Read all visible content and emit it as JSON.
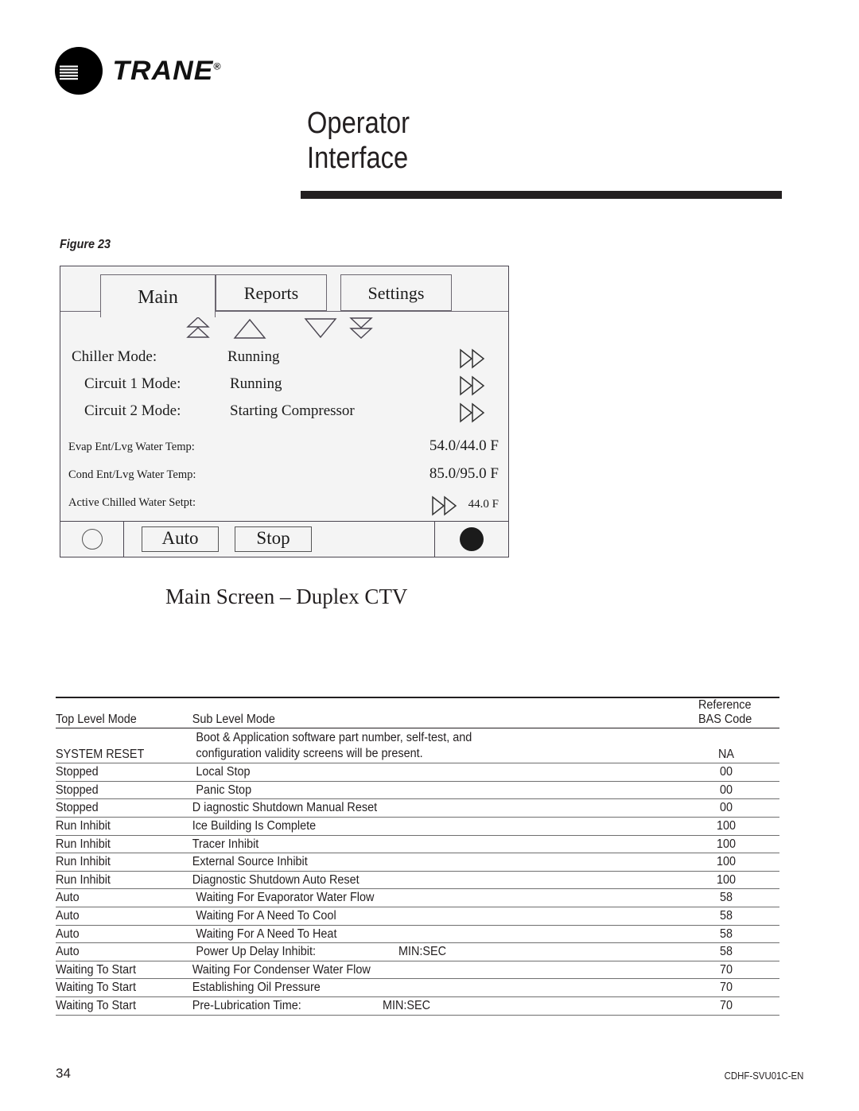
{
  "brand": {
    "name": "TRANE",
    "registered_mark": "®",
    "logo_icon": "trane-circle-logo"
  },
  "header": {
    "title": "Operator\nInterface"
  },
  "figure": {
    "label": "Figure 23",
    "caption": "Main Screen – Duplex CTV"
  },
  "device": {
    "tabs": [
      {
        "id": "main",
        "label": "Main",
        "active": true
      },
      {
        "id": "reports",
        "label": "Reports",
        "active": false
      },
      {
        "id": "settings",
        "label": "Settings",
        "active": false
      }
    ],
    "nav_arrows": [
      {
        "icon": "double-up-arrow-icon"
      },
      {
        "icon": "up-arrow-icon"
      },
      {
        "icon": "down-arrow-icon"
      },
      {
        "icon": "double-down-arrow-icon"
      }
    ],
    "mode_rows": [
      {
        "label": "Chiller Mode:",
        "value": "Running",
        "chevron": "double-right-chevron-icon"
      },
      {
        "label": "Circuit 1 Mode:",
        "value": "Running",
        "chevron": "double-right-chevron-icon"
      },
      {
        "label": "Circuit 2 Mode:",
        "value": "Starting Compressor",
        "chevron": "double-right-chevron-icon"
      }
    ],
    "temp_rows": [
      {
        "label": "Evap Ent/Lvg Water Temp:",
        "value": "54.0/44.0 F"
      },
      {
        "label": "Cond Ent/Lvg Water Temp:",
        "value": "85.0/95.0 F"
      },
      {
        "label": "Active Chilled Water  Setpt:",
        "value": "44.0 F",
        "chevron": "double-right-chevron-icon"
      }
    ],
    "controls": {
      "left_indicator": "open-circle-indicator",
      "auto_label": "Auto",
      "stop_label": "Stop",
      "right_indicator": "filled-circle-indicator"
    }
  },
  "table": {
    "headers": {
      "top_level": "Top Level Mode",
      "sub_level": "Sub Level Mode",
      "reference": "Reference",
      "bas_code": "BAS Code"
    },
    "rows": [
      {
        "top": "SYSTEM RESET",
        "sub_lines": [
          "Boot & Application software part number, self-test, and",
          "configuration validity screens will be present."
        ],
        "bas": "NA",
        "tall": true
      },
      {
        "top": "Stopped",
        "sub": "Local Stop",
        "bas": "00"
      },
      {
        "top": "Stopped",
        "sub": "Panic Stop",
        "bas": "00"
      },
      {
        "top": "Stopped",
        "sub": "D iagnostic Shutdown   Manual Reset",
        "bas": "00"
      },
      {
        "top": "Run Inhibit",
        "sub": "Ice Building Is Complete",
        "bas": "100"
      },
      {
        "top": "Run Inhibit",
        "sub": "Tracer Inhibit",
        "bas": "100"
      },
      {
        "top": "Run Inhibit",
        "sub": "External Source Inhibit",
        "bas": "100"
      },
      {
        "top": "Run Inhibit",
        "sub": "Diagnostic Shutdown   Auto Reset",
        "bas": "100"
      },
      {
        "top": "Auto",
        "sub": "Waiting For Evaporator Water Flow",
        "bas": "58"
      },
      {
        "top": "Auto",
        "sub": "Waiting For A Need To Cool",
        "bas": "58"
      },
      {
        "top": "Auto",
        "sub": "Waiting For A Need To Heat",
        "bas": "58"
      },
      {
        "top": "Auto",
        "sub": "Power Up Delay Inhibit:",
        "sub_extra": "MIN:SEC",
        "bas": "58"
      },
      {
        "top": "Waiting To Start",
        "sub": "Waiting For Condenser Water Flow",
        "bas": "70"
      },
      {
        "top": "Waiting To Start",
        "sub": "Establishing Oil Pressure",
        "bas": "70"
      },
      {
        "top": "Waiting To Start",
        "sub": "Pre-Lubrication Time:",
        "sub_extra": "MIN:SEC",
        "bas": "70"
      }
    ]
  },
  "footer": {
    "page_number": "34",
    "document_code": "CDHF-SVU01C-EN"
  }
}
